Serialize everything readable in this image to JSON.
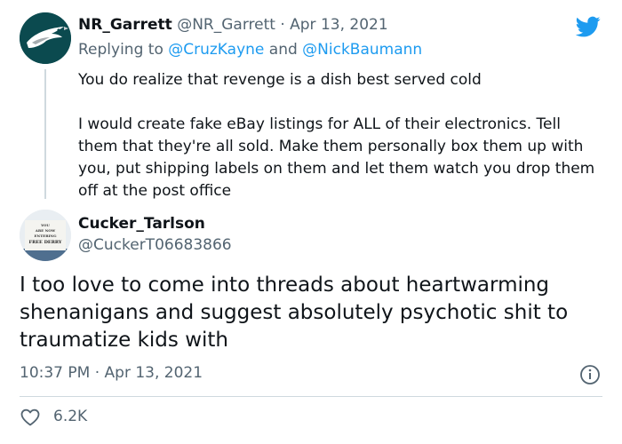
{
  "tweet1": {
    "display_name": "NR_Garrett",
    "handle": "@NR_Garrett",
    "separator": "·",
    "date": "Apr 13, 2021",
    "replying_to": {
      "prefix": "Replying to",
      "mention1": "@CruzKayne",
      "conjunction": "and",
      "mention2": "@NickBaumann"
    },
    "paragraph1": "You do realize that revenge is a dish best served cold",
    "paragraph2": "I would create fake eBay listings for ALL of their electronics. Tell them that they're all sold. Make them personally box them up with you, put shipping labels on them and let them watch you drop them off at the post office",
    "avatar_icon": "eagle-logo-icon"
  },
  "tweet2": {
    "display_name": "Cucker_Tarlson",
    "handle": "@CuckerT06683866",
    "body": "I too love to come into threads about heartwarming shenanigans and suggest absolutely psychotic shit to traumatize kids with",
    "timestamp": "10:37 PM · Apr 13, 2021",
    "likes": "6.2K",
    "avatar_sign_text": [
      "YOU",
      "ARE NOW",
      "ENTERING",
      "FREE DERRY"
    ]
  },
  "icons": {
    "brand": "twitter-bird-icon",
    "info": "info-icon",
    "like": "heart-icon"
  },
  "colors": {
    "brand_blue": "#1d9bf0",
    "text": "#0f1419",
    "muted": "#536471",
    "divider": "#cfd9de"
  }
}
